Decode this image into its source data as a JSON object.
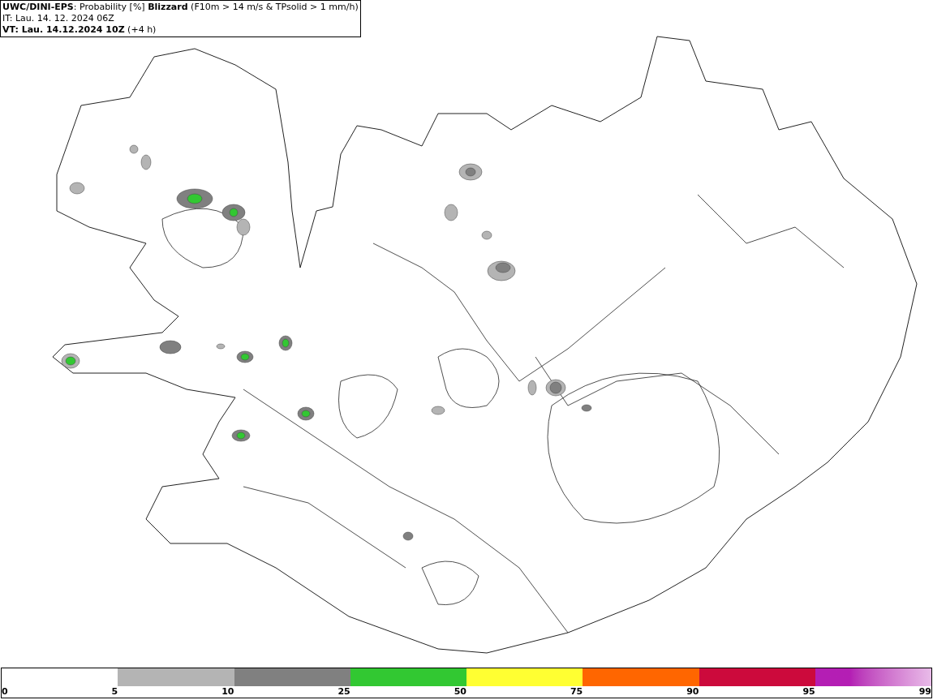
{
  "header": {
    "title": "**UWC/DINI-EPS**: Probability [%] **Blizzard** (F10m > 14 m/s & TPsolid > 1 mm/h)",
    "initial_time": "IT: Lau. 14. 12. 2024 06Z",
    "valid_time": "**VT: Lau. 14.12.2024 10Z** (+4 h)"
  },
  "legend": {
    "segments": [
      {
        "kind": "blank"
      },
      {
        "kind": "solid",
        "color": "#b4b4b4"
      },
      {
        "kind": "solid",
        "color": "#808080"
      },
      {
        "kind": "solid",
        "color": "#32c832"
      },
      {
        "kind": "solid",
        "color": "#ffff32"
      },
      {
        "kind": "solid",
        "color": "#ff6600"
      },
      {
        "kind": "solid",
        "color": "#cc0a3c"
      },
      {
        "kind": "gradient",
        "color": "#b41eb4"
      }
    ],
    "ticks": [
      "0",
      "5",
      "10",
      "25",
      "50",
      "75",
      "90",
      "95",
      "99"
    ]
  }
}
